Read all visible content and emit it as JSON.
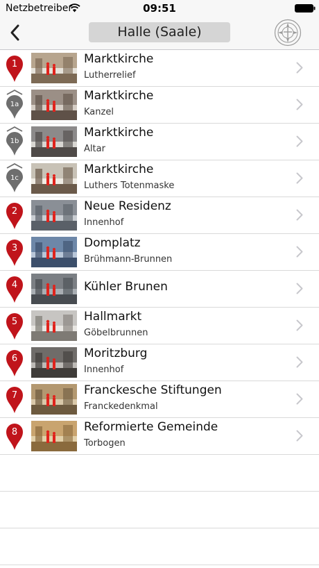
{
  "status": {
    "carrier": "Netzbetreiber",
    "time": "09:51"
  },
  "nav": {
    "title": "Halle (Saale)"
  },
  "colors": {
    "pin_red": "#c0141b",
    "pin_gray": "#6e6e6e",
    "nav_bg": "#f7f7f7",
    "title_box_bg": "#d5d5d5"
  },
  "items": [
    {
      "pin_label": "1",
      "pin_style": "red",
      "title": "Marktkirche",
      "subtitle": "Lutherrelief"
    },
    {
      "pin_label": "1a",
      "pin_style": "gray",
      "title": "Marktkirche",
      "subtitle": "Kanzel"
    },
    {
      "pin_label": "1b",
      "pin_style": "gray",
      "title": "Marktkirche",
      "subtitle": "Altar"
    },
    {
      "pin_label": "1c",
      "pin_style": "gray",
      "title": "Marktkirche",
      "subtitle": "Luthers Totenmaske"
    },
    {
      "pin_label": "2",
      "pin_style": "red",
      "title": "Neue Residenz",
      "subtitle": "Innenhof"
    },
    {
      "pin_label": "3",
      "pin_style": "red",
      "title": "Domplatz",
      "subtitle": "Brühmann-Brunnen"
    },
    {
      "pin_label": "4",
      "pin_style": "red",
      "title": "Kühler Brunen",
      "subtitle": ""
    },
    {
      "pin_label": "5",
      "pin_style": "red",
      "title": "Hallmarkt",
      "subtitle": "Göbelbrunnen"
    },
    {
      "pin_label": "6",
      "pin_style": "red",
      "title": "Moritzburg",
      "subtitle": "Innenhof"
    },
    {
      "pin_label": "7",
      "pin_style": "red",
      "title": "Franckesche Stiftungen",
      "subtitle": "Franckedenkmal"
    },
    {
      "pin_label": "8",
      "pin_style": "red",
      "title": "Reformierte Gemeinde",
      "subtitle": "Torbogen"
    }
  ]
}
